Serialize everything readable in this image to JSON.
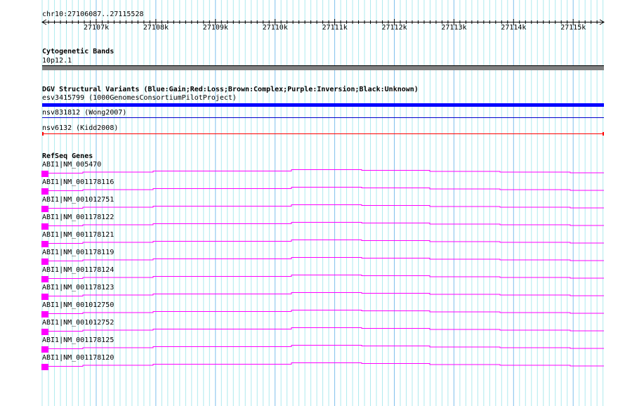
{
  "ruler": {
    "location": "chr10:27106087..27115528",
    "ticks": [
      "27107k",
      "27108k",
      "27109k",
      "27110k",
      "27111k",
      "27112k",
      "27113k",
      "27114k",
      "27115k"
    ]
  },
  "cytoband": {
    "title": "Cytogenetic Bands",
    "band": "10p12.1"
  },
  "dgv": {
    "title": "DGV Structural Variants (Blue:Gain;Red:Loss;Brown:Complex;Purple:Inversion;Black:Unknown)",
    "features": [
      {
        "label": "esv3415799 (1000GenomesConsortiumPilotProject)",
        "color": "#0000ff"
      },
      {
        "label": "nsv831812 (Wong2007)",
        "color": "#0000cc"
      },
      {
        "label": "nsv6132 (Kidd2008)",
        "color": "#ff0000"
      }
    ]
  },
  "refseq": {
    "title": "RefSeq Genes",
    "color": "#ff00ff",
    "genes": [
      "ABI1|NM_005470",
      "ABI1|NM_001178116",
      "ABI1|NM_001012751",
      "ABI1|NM_001178122",
      "ABI1|NM_001178121",
      "ABI1|NM_001178119",
      "ABI1|NM_001178124",
      "ABI1|NM_001178123",
      "ABI1|NM_001012750",
      "ABI1|NM_001012752",
      "ABI1|NM_001178125",
      "ABI1|NM_001178120"
    ]
  }
}
